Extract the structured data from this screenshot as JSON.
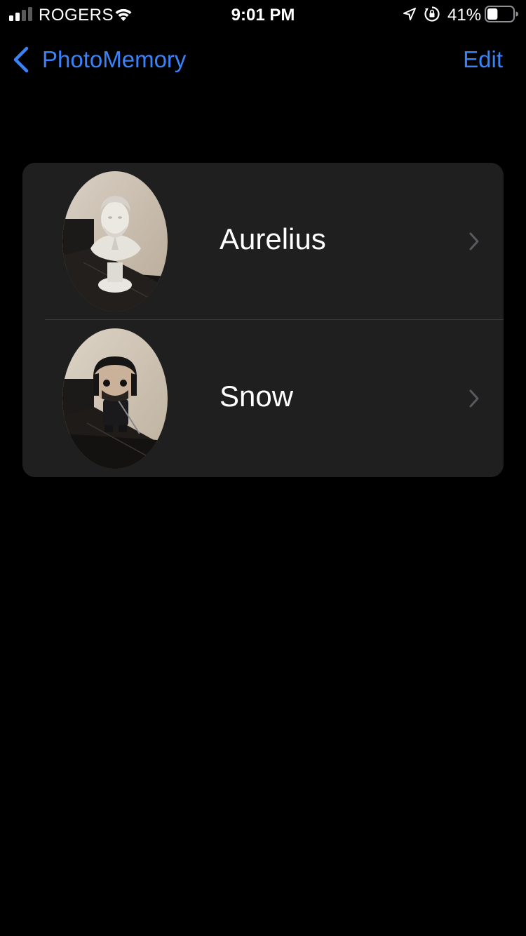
{
  "status_bar": {
    "carrier": "ROGERS",
    "time": "9:01 PM",
    "battery_percent": "41%",
    "battery_level": 0.41,
    "signal_bars": 2,
    "icons": [
      "signal-icon",
      "wifi-icon",
      "location-icon",
      "orientation-lock-icon",
      "battery-icon"
    ]
  },
  "nav": {
    "back_label": "PhotoMemory",
    "edit_label": "Edit",
    "accent_color": "#3a82f7"
  },
  "list": {
    "items": [
      {
        "label": "Aurelius",
        "thumbnail": "marble bust statue photo"
      },
      {
        "label": "Snow",
        "thumbnail": "vinyl figure photo"
      }
    ]
  },
  "colors": {
    "background": "#000000",
    "card": "#1f1f1f",
    "divider": "#3a3a3c",
    "chevron": "#5a5a5e"
  }
}
